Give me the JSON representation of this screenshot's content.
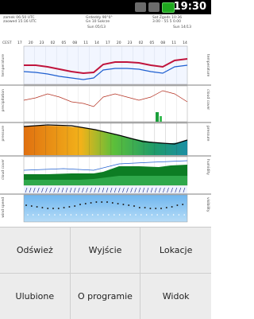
{
  "statusbar": {
    "time": "19:30"
  },
  "forecast": {
    "header_left_1": "zamek 06:50 UTC",
    "header_left_2": "zaowed 15:16 UTC",
    "header_mid_1": "Grdeddy 90°0°",
    "header_mid_2": "Gn 10 Sokrze",
    "header_right_1": "Sat Zgods 10:36",
    "header_right_2": "3.00 - 55 5 0.00",
    "date_left": "Sun 05/13",
    "date_right": "Sun 14/13",
    "hour_label": "CEST",
    "hours": [
      "17",
      "20",
      "23",
      "02",
      "05",
      "08",
      "11",
      "14",
      "17",
      "20",
      "23",
      "02",
      "05",
      "08",
      "11",
      "14"
    ],
    "panel_labels": [
      {
        "left": "temperature",
        "right": "temperature"
      },
      {
        "left": "precipitation",
        "right": "cloud cover"
      },
      {
        "left": "pressure",
        "right": "pressure"
      },
      {
        "left": "cloud cover",
        "right": "humidity"
      },
      {
        "left": "wind speed",
        "right": "visibility"
      }
    ],
    "colors": {
      "temp_red": "#c0143c",
      "temp_blue": "#1e5fd0",
      "pressure_gradient_start": "#e8741a",
      "pressure_gradient_end": "#1f8fa0",
      "cloud_green": "#0d7d24",
      "sky_blue": "#5aa9e6"
    }
  },
  "menu": {
    "items": [
      {
        "label": "Odśwież"
      },
      {
        "label": "Wyjście"
      },
      {
        "label": "Lokacje"
      },
      {
        "label": "Ulubione"
      },
      {
        "label": "O programie"
      },
      {
        "label": "Widok"
      }
    ]
  }
}
